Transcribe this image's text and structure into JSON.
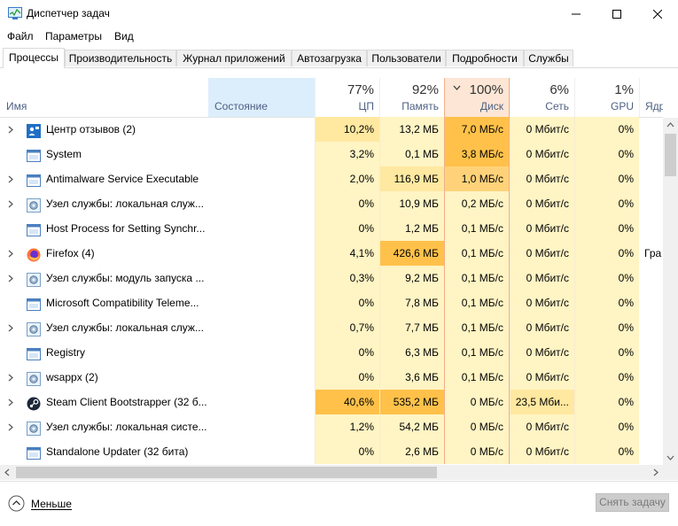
{
  "window": {
    "title": "Диспетчер задач",
    "minimize_icon": "minimize-icon",
    "maximize_icon": "maximize-icon",
    "close_icon": "close-icon"
  },
  "menu": [
    "Файл",
    "Параметры",
    "Вид"
  ],
  "tabs": [
    "Процессы",
    "Производительность",
    "Журнал приложений",
    "Автозагрузка",
    "Пользователи",
    "Подробности",
    "Службы"
  ],
  "active_tab": 0,
  "columns": {
    "name": {
      "label": "Имя"
    },
    "status": {
      "label": "Состояние"
    },
    "cpu": {
      "label": "ЦП",
      "pct": "77%"
    },
    "memory": {
      "label": "Память",
      "pct": "92%"
    },
    "disk": {
      "label": "Диск",
      "pct": "100%",
      "sort_icon": "sort-desc-icon"
    },
    "network": {
      "label": "Сеть",
      "pct": "6%"
    },
    "gpu": {
      "label": "GPU",
      "pct": "1%"
    },
    "gpu_engine": {
      "label": "Ядро G"
    }
  },
  "processes": [
    {
      "name": "Центр отзывов (2)",
      "icon": "feedback-hub-icon",
      "expandable": true,
      "status": "",
      "cpu": "10,2%",
      "memory": "13,2 МБ",
      "disk": "7,0 МБ/с",
      "network": "0 Мбит/с",
      "gpu": "0%",
      "gpu_engine": ""
    },
    {
      "name": "System",
      "icon": "window-app-icon",
      "expandable": false,
      "status": "",
      "cpu": "3,2%",
      "memory": "0,1 МБ",
      "disk": "3,8 МБ/с",
      "network": "0 Мбит/с",
      "gpu": "0%",
      "gpu_engine": ""
    },
    {
      "name": "Antimalware Service Executable",
      "icon": "window-app-icon",
      "expandable": true,
      "status": "",
      "cpu": "2,0%",
      "memory": "116,9 МБ",
      "disk": "1,0 МБ/с",
      "network": "0 Мбит/с",
      "gpu": "0%",
      "gpu_engine": ""
    },
    {
      "name": "Узел службы: локальная служ...",
      "icon": "gear-icon",
      "expandable": true,
      "status": "",
      "cpu": "0%",
      "memory": "10,9 МБ",
      "disk": "0,2 МБ/с",
      "network": "0 Мбит/с",
      "gpu": "0%",
      "gpu_engine": ""
    },
    {
      "name": "Host Process for Setting Synchr...",
      "icon": "window-app-icon",
      "expandable": false,
      "status": "",
      "cpu": "0%",
      "memory": "1,2 МБ",
      "disk": "0,1 МБ/с",
      "network": "0 Мбит/с",
      "gpu": "0%",
      "gpu_engine": ""
    },
    {
      "name": "Firefox (4)",
      "icon": "firefox-icon",
      "expandable": true,
      "status": "",
      "cpu": "4,1%",
      "memory": "426,6 МБ",
      "disk": "0,1 МБ/с",
      "network": "0 Мбит/с",
      "gpu": "0%",
      "gpu_engine": "Гра"
    },
    {
      "name": "Узел службы: модуль запуска ...",
      "icon": "gear-icon",
      "expandable": true,
      "status": "",
      "cpu": "0,3%",
      "memory": "9,2 МБ",
      "disk": "0,1 МБ/с",
      "network": "0 Мбит/с",
      "gpu": "0%",
      "gpu_engine": ""
    },
    {
      "name": "Microsoft Compatibility Teleme...",
      "icon": "window-app-icon",
      "expandable": false,
      "status": "",
      "cpu": "0%",
      "memory": "7,8 МБ",
      "disk": "0,1 МБ/с",
      "network": "0 Мбит/с",
      "gpu": "0%",
      "gpu_engine": ""
    },
    {
      "name": "Узел службы: локальная служ...",
      "icon": "gear-icon",
      "expandable": true,
      "status": "",
      "cpu": "0,7%",
      "memory": "7,7 МБ",
      "disk": "0,1 МБ/с",
      "network": "0 Мбит/с",
      "gpu": "0%",
      "gpu_engine": ""
    },
    {
      "name": "Registry",
      "icon": "window-app-icon",
      "expandable": false,
      "status": "",
      "cpu": "0%",
      "memory": "6,3 МБ",
      "disk": "0,1 МБ/с",
      "network": "0 Мбит/с",
      "gpu": "0%",
      "gpu_engine": ""
    },
    {
      "name": "wsappx (2)",
      "icon": "gear-icon",
      "expandable": true,
      "status": "",
      "cpu": "0%",
      "memory": "3,6 МБ",
      "disk": "0,1 МБ/с",
      "network": "0 Мбит/с",
      "gpu": "0%",
      "gpu_engine": ""
    },
    {
      "name": "Steam Client Bootstrapper (32 б...",
      "icon": "steam-icon",
      "expandable": true,
      "status": "",
      "cpu": "40,6%",
      "memory": "535,2 МБ",
      "disk": "0 МБ/с",
      "network": "23,5 Мби...",
      "gpu": "0%",
      "gpu_engine": ""
    },
    {
      "name": "Узел службы: локальная систе...",
      "icon": "gear-icon",
      "expandable": true,
      "status": "",
      "cpu": "1,2%",
      "memory": "54,2 МБ",
      "disk": "0 МБ/с",
      "network": "0 Мбит/с",
      "gpu": "0%",
      "gpu_engine": ""
    },
    {
      "name": "Standalone Updater (32 бита)",
      "icon": "window-app-icon",
      "expandable": false,
      "status": "",
      "cpu": "0%",
      "memory": "2,6 МБ",
      "disk": "0 МБ/с",
      "network": "0 Мбит/с",
      "gpu": "0%",
      "gpu_engine": ""
    }
  ],
  "footer": {
    "less_label": "Меньше",
    "less_icon": "chevron-up-circle-icon",
    "end_task_label": "Снять задачу"
  },
  "colors": {
    "heat_low": "#fff4c4",
    "heat_mid": "#ffe8a0",
    "heat_high": "#ffd27a",
    "heat_max": "#ffc14a",
    "status_header_bg": "#dceefc",
    "disk_header_bg": "#fde6d5",
    "disk_header_border": "#f2b08a",
    "header_label": "#4d6082"
  }
}
